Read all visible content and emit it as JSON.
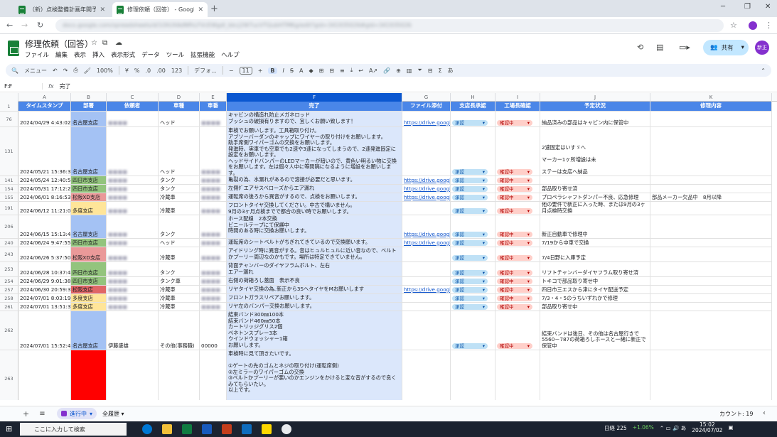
{
  "browser": {
    "tabs": [
      {
        "title": "（新）点検整備計画年間予定表",
        "active": false
      },
      {
        "title": "修理依頼（回答） - Google スプ",
        "active": true
      }
    ],
    "url": "docs.google.com/spreadsheets/d/1OtUXAdNfhLFVcEWgdl_bkcj2W7ucVTQubHTMKg/edit?gid=341935026#gid=341935026"
  },
  "doc": {
    "title": "修理依頼（回答）",
    "menus": [
      "ファイル",
      "編集",
      "表示",
      "挿入",
      "表示形式",
      "データ",
      "ツール",
      "拡張機能",
      "ヘルプ"
    ],
    "share_label": "共有",
    "avatar": "新正"
  },
  "toolbar": {
    "search": "メニュー",
    "zoom": "100%",
    "currency": "¥",
    "percent": "%",
    "dec_less": ".0",
    "dec_more": ".00",
    "num_fmt": "123",
    "font": "デフォ...",
    "font_size": "11",
    "bold": "B",
    "italic": "I"
  },
  "formula_bar": {
    "ref": "F:F",
    "fx": "fx",
    "value": "完了"
  },
  "columns": [
    "A",
    "B",
    "C",
    "D",
    "E",
    "F",
    "G",
    "H",
    "I",
    "J",
    "K"
  ],
  "header_row": {
    "num": "1",
    "cells": [
      "タイムスタンプ",
      "部署",
      "依頼者",
      "車種",
      "車番",
      "完了",
      "ファイル添付",
      "支店長承認",
      "工場長確認",
      "予定状況",
      "修理内容"
    ]
  },
  "rows": [
    {
      "num": "76",
      "ts": "2024/04/29 4:43:02",
      "dept": "名古屋支店",
      "req": "",
      "car": "ヘッド",
      "no": "",
      "desc": "キャビンの構造れ防止メガネロッド\nブッシュの破損有りますので、宜しくお願い致します！",
      "file": "https://drive.google.",
      "appr": "承認",
      "conf": "確認中",
      "status": "納品済みの部品はキャビン内に保管中",
      "detail": ""
    },
    {
      "num": "131",
      "ts": "2024/05/21 15:36:31",
      "dept": "名古屋支店",
      "req": "",
      "car": "ヘッド",
      "no": "",
      "desc": "車検でお願いします。工具箱取り付け。\nアブソーバーダンのキャップにワイヤーの取り付けをお願いします。\n助手席側ワイパーゴムの交換をお願いします。\n発進時、実車でも空車でも2速や3速になってしまうので、2速発進固定に設定をお願いします。\nヘッドサイドバンパーのLEDマーカーが暗いので、黄色い明るい物に交換をお願いします。左は個々人中に等間隔になるように増設をお願いします。",
      "file": "",
      "appr": "承認",
      "conf": "確認中",
      "status": "2速固定はいすゞへ\n\nマーカー1ヶ所増設は未\n\nステーは支店へ納品",
      "detail": ""
    },
    {
      "num": "141",
      "ts": "2024/05/24 12:40:55",
      "dept": "四日市支店",
      "req": "",
      "car": "タンク",
      "no": "",
      "desc": "亀裂の為、水漏れがあるので溶接が必要だと思います。",
      "file": "https://drive.google.",
      "appr": "承認",
      "conf": "確認中",
      "status": "",
      "detail": ""
    },
    {
      "num": "154",
      "ts": "2024/05/31 17:12:24",
      "dept": "四日市支店",
      "req": "",
      "car": "タンク",
      "no": "",
      "desc": "左側ﾀﾞエアサスベローズからエア漏れ",
      "file": "https://drive.google.",
      "appr": "承認",
      "conf": "確認中",
      "status": "部品取り寄せ済",
      "detail": ""
    },
    {
      "num": "155",
      "ts": "2024/06/01 8:16:53",
      "dept": "松阪XD支店",
      "req": "",
      "car": "冷蔵車",
      "no": "",
      "desc": "運転席の後ろから異音がするので、点検をお願いします。",
      "file": "https://drive.google.",
      "appr": "承認",
      "conf": "確認中",
      "status": "プロペラシャフトダンパー不良、応急修理",
      "detail": "部品メーカー欠品中　8月以降"
    },
    {
      "num": "191",
      "ts": "2024/06/12 11:21:00",
      "dept": "多度支店",
      "req": "",
      "car": "冷蔵車",
      "no": "",
      "desc": "フロントタイヤ交換してください。中古で構いません。\n9月の3ヶ月点検までで都合の良い時でお願いします。",
      "file": "",
      "appr": "承認",
      "conf": "確認中",
      "status": "他の要件で新正に入った時、または9月の3ヶ月点検時交換",
      "detail": ""
    },
    {
      "num": "206",
      "ts": "2024/06/15 15:13:43",
      "dept": "名古屋支店",
      "req": "",
      "car": "タンク",
      "no": "",
      "desc": "ホース配線　2本交換\nビニールテープにて保護中\n時間のある時に交換お願いします。",
      "file": "https://drive.google.",
      "appr": "承認",
      "conf": "確認中",
      "status": "新正自動車で修理中",
      "detail": ""
    },
    {
      "num": "240",
      "ts": "2024/06/24 9:47:55",
      "dept": "四日市支店",
      "req": "",
      "car": "ヘッド",
      "no": "",
      "desc": "運転席のシートベルトがちぎれてきているので交換願います。",
      "file": "https://drive.google.",
      "appr": "承認",
      "conf": "確認中",
      "status": "7/19から中車で交換",
      "detail": ""
    },
    {
      "num": "243",
      "ts": "2024/06/26 5:37:50",
      "dept": "松阪XD支店",
      "req": "",
      "car": "冷蔵車",
      "no": "",
      "desc": "アイドリング時に異音がする。音はヒュルヒュルに近い音なので、ベルトかプーリー周辺なのかもです。場所は特定できていません。",
      "file": "",
      "appr": "承認",
      "conf": "確認中",
      "status": "7/4日野に入庫予定",
      "detail": ""
    },
    {
      "num": "253",
      "ts": "2024/06/28 10:37:42",
      "dept": "四日市支店",
      "req": "",
      "car": "タンク",
      "no": "",
      "desc": "背面チャンバーのダイヤフラムボルト、左右\nエアー漏れ",
      "file": "",
      "appr": "承認",
      "conf": "確認中",
      "status": "リフトチャンバーダイヤフラム取り寄せ済",
      "detail": ""
    },
    {
      "num": "254",
      "ts": "2024/06/29 9:01:38",
      "dept": "四日市支店",
      "req": "",
      "car": "タンク車",
      "no": "",
      "desc": "右側の荷箱ろし蓋面　表示不良",
      "file": "",
      "appr": "承認",
      "conf": "確認中",
      "status": "トキコで部品取り寄せ中",
      "detail": ""
    },
    {
      "num": "257",
      "ts": "2024/06/30 20:59:31",
      "dept": "松阪支店",
      "req": "",
      "car": "冷蔵車",
      "no": "",
      "desc": "リヤタイヤ交換の為､新正から3SヘタイヤをMお願いします",
      "file": "https://drive.google.",
      "appr": "承認",
      "conf": "確認中",
      "status": "四日市三エスから津にタイヤ配送予定",
      "detail": ""
    },
    {
      "num": "258",
      "ts": "2024/07/01 8:03:19",
      "dept": "多度支店",
      "req": "",
      "car": "冷蔵車",
      "no": "",
      "desc": "フロントガラスリペアお願いします。",
      "file": "",
      "appr": "承認",
      "conf": "確認中",
      "status": "7/3・4・5のうちいずれかで修理",
      "detail": ""
    },
    {
      "num": "261",
      "ts": "2024/07/01 13:51:35",
      "dept": "多度支店",
      "req": "",
      "car": "冷蔵車",
      "no": "",
      "desc": "リヤ左のバンパー交換お願いします。",
      "file": "",
      "appr": "承認",
      "conf": "確認中",
      "status": "部品取り寄せ中",
      "detail": ""
    },
    {
      "num": "262",
      "ts": "2024/07/01 15:52:40",
      "dept": "名古屋支店",
      "req": "伊藤盛雄",
      "car": "その他(事務職)",
      "no": "00000",
      "desc": "結束バンド300㎜100本\n結束バンド460㎜50本\nカートリッジグリス2個\nペネトンスプレー3本\nウインドウォッシャー1箱\nお願いします。",
      "file": "",
      "appr": "承認",
      "conf": "確認中",
      "status": "結束バンドは後日、その他は名古屋行きで5560－787の荷箱ろしホースと一緒に新正で保管中",
      "detail": ""
    },
    {
      "num": "263",
      "ts": "",
      "dept": "",
      "req": "",
      "car": "",
      "no": "",
      "desc": "車検時に見て頂きたいです。\n\n①ゲートの先のゴムとネジの取り付け(運転席側)\n②左ミラーのワイパーゴムの交換\n③ベルトかプーリーが悪いのかエンジンをかけると変な音がするので良くみてもらいたい。\n以上です。",
      "file": "",
      "appr": "",
      "conf": "",
      "status": "",
      "detail": ""
    }
  ],
  "sheets": {
    "active": "進行中",
    "other": "全履歴"
  },
  "count_label": "カウント: 19",
  "taskbar": {
    "search": "ここに入力して検索",
    "stock": "日経 225",
    "change": "+1.06%",
    "time": "15:02",
    "date": "2024/07/02"
  },
  "colors": {
    "header_blue": "#4a86e8",
    "col_f": "#dbe7fb",
    "nagoya": "#a4c2f4",
    "yokkaichi": "#93c47d",
    "matsusaka_xd": "#ea9999",
    "tado": "#ffe599",
    "matsusaka": "#e06666",
    "approve_chip": "#bfe1f6",
    "check_chip": "#ffcfc9"
  }
}
